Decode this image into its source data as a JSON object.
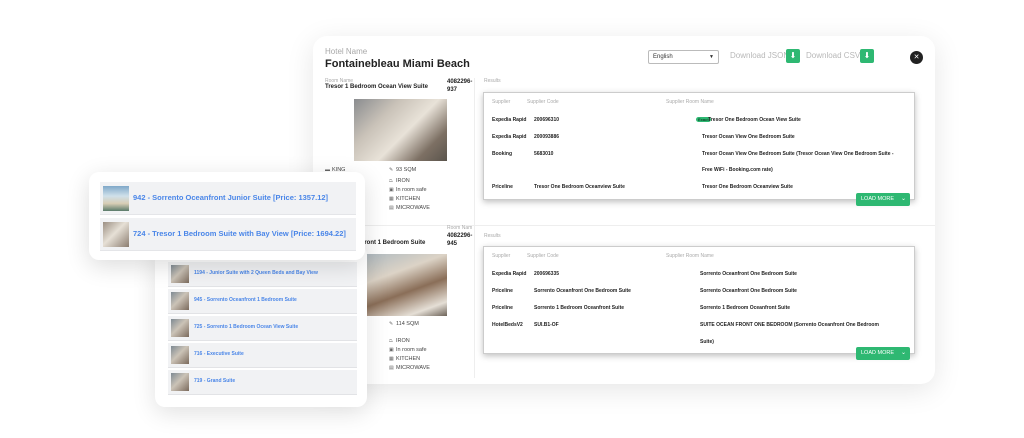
{
  "header": {
    "hotel_label": "Hotel Name",
    "hotel_name": "Fontainebleau Miami Beach",
    "language": "English",
    "download_json": "Download JSON",
    "download_csv": "Download CSV"
  },
  "room1": {
    "label": "Room Name",
    "name": "Tresor 1 Bedroom Ocean View Suite",
    "code": "4082296-937",
    "bed": "KING",
    "size": "93 SQM",
    "amenities": [
      "IRON",
      "In room safe",
      "KITCHEN",
      "MICROWAVE"
    ],
    "results_label": "Results",
    "headers": {
      "supplier": "Supplier",
      "code": "Supplier Code",
      "room": "Supplier Room Name"
    },
    "rows": [
      {
        "supplier": "Expedia Rapid",
        "code": "200696310",
        "tag": "Exact",
        "room": "Tresor One Bedroom Ocean View Suite"
      },
      {
        "supplier": "Expedia Rapid",
        "code": "200093886",
        "room": "Tresor Ocean View One Bedroom Suite"
      },
      {
        "supplier": "Booking",
        "code": "5683010",
        "room": "Tresor Ocean View One Bedroom Suite (Tresor Ocean View One Bedroom Suite -",
        "room2": "Free WiFi - Booking.com rate)"
      },
      {
        "supplier": "Priceline",
        "code": "Tresor One Bedroom Oceanview Suite",
        "room": "Tresor One Bedroom Oceanview Suite"
      }
    ],
    "load_more": "LOAD MORE"
  },
  "room2": {
    "label": "Room Nam",
    "name": "rrento Oceanfront 1 Bedroom Suite",
    "code": "4082296-945",
    "size": "114 SQM",
    "amenities": [
      "IRON",
      "In room safe",
      "KITCHEN",
      "MICROWAVE"
    ],
    "results_label": "Results",
    "headers": {
      "supplier": "Supplier",
      "code": "Supplier Code",
      "room": "Supplier Room Name"
    },
    "rows": [
      {
        "supplier": "Expedia Rapid",
        "code": "200696335",
        "room": "Sorrento Oceanfront One Bedroom Suite"
      },
      {
        "supplier": "Priceline",
        "code": "Sorrento Oceanfront One Bedroom Suite",
        "room": "Sorrento Oceanfront One Bedroom Suite"
      },
      {
        "supplier": "Priceline",
        "code": "Sorrento 1 Bedroom Oceanfront Suite",
        "room": "Sorrento 1 Bedroom Oceanfront Suite"
      },
      {
        "supplier": "HotelBedsV2",
        "code": "SUI.B1-OF",
        "room": "SUITE OCEAN FRONT ONE BEDROOM (Sorrento Oceanfront One Bedroom",
        "room2": "Suite)"
      }
    ],
    "load_more": "LOAD MORE"
  },
  "popup": {
    "items": [
      {
        "text": "942   - Sorrento Oceanfront Junior Suite [Price: 1357.12]"
      },
      {
        "text": "724   - Tresor 1 Bedroom Suite with Bay View [Price: 1694.22]"
      }
    ]
  },
  "list": {
    "items": [
      {
        "text": "1194  - Junior Suite with 2 Queen Beds and Bay View"
      },
      {
        "text": "945  - Sorrento Oceanfront 1 Bedroom Suite"
      },
      {
        "text": "725  - Sorrento 1 Bedroom Ocean View Suite"
      },
      {
        "text": "716  - Executive Suite"
      },
      {
        "text": "719  - Grand Suite"
      }
    ]
  },
  "icons": {
    "accent": "#2eb872",
    "link": "#4a86e8"
  }
}
